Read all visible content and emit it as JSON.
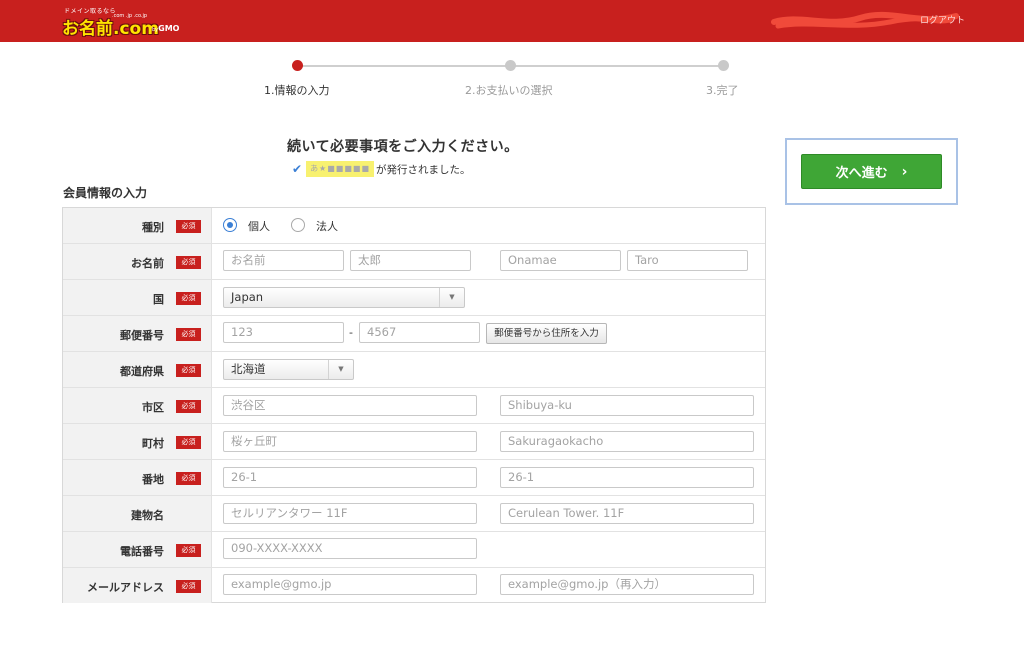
{
  "header": {
    "logo_tagline": "ドメイン取るなら",
    "logo_tlds": ".com .jp .co.jp",
    "logo_brand": "お名前.com",
    "logo_by": "by",
    "logo_gmo": "GMO",
    "right_link": "ログアウト"
  },
  "steps": [
    {
      "label": "1.情報の入力"
    },
    {
      "label": "2.お支払いの選択"
    },
    {
      "label": "3.完了"
    }
  ],
  "heading": "続いて必要事項をご入力ください。",
  "issued": {
    "redacted_text": "あ★■■■■■",
    "message": "が発行されました。"
  },
  "section_title": "会員情報の入力",
  "next_button": {
    "label": "次へ進む",
    "icon": "chevron-right-icon"
  },
  "required_badge": "必須",
  "form": {
    "type": {
      "label": "種別",
      "options": [
        "個人",
        "法人"
      ],
      "selected": "個人"
    },
    "name": {
      "label": "お名前",
      "last_placeholder": "お名前",
      "first_placeholder": "太郎",
      "last_roman_placeholder": "Onamae",
      "first_roman_placeholder": "Taro"
    },
    "country": {
      "label": "国",
      "value": "Japan"
    },
    "postal": {
      "label": "郵便番号",
      "part1_placeholder": "123",
      "separator": "-",
      "part2_placeholder": "4567",
      "lookup_button": "郵便番号から住所を入力"
    },
    "prefecture": {
      "label": "都道府県",
      "value": "北海道"
    },
    "city": {
      "label": "市区",
      "placeholder": "渋谷区",
      "roman_placeholder": "Shibuya-ku"
    },
    "town": {
      "label": "町村",
      "placeholder": "桜ヶ丘町",
      "roman_placeholder": "Sakuragaokacho"
    },
    "address": {
      "label": "番地",
      "placeholder": "26-1",
      "roman_placeholder": "26-1"
    },
    "building": {
      "label": "建物名",
      "placeholder": "セルリアンタワー 11F",
      "roman_placeholder": "Cerulean Tower. 11F"
    },
    "phone": {
      "label": "電話番号",
      "placeholder": "090-XXXX-XXXX"
    },
    "email": {
      "label": "メールアドレス",
      "placeholder": "example@gmo.jp",
      "confirm_placeholder": "example@gmo.jp（再入力）"
    }
  },
  "colors": {
    "brand_red": "#c8201e",
    "accent_green": "#3fa636",
    "radio_blue": "#3a7fd5",
    "highlight_yellow": "#f8f170"
  }
}
